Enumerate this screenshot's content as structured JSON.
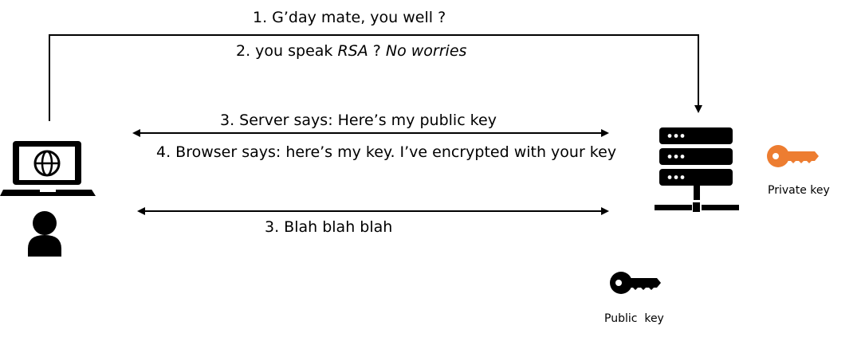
{
  "messages": {
    "m1": "1. G’day mate, you well ?",
    "m2_prefix": "2. you speak ",
    "m2_rsa": "RSA",
    "m2_middle": " ? ",
    "m2_suffix": "No worries",
    "m3": "3. Server says: Here’s my public key",
    "m4": "4. Browser says: here’s my key. I’ve encrypted with your key",
    "m5": "3. Blah blah blah"
  },
  "keys": {
    "private_label": "Private key",
    "public_label": "Public  key"
  },
  "icons": {
    "laptop": "laptop-globe-icon",
    "user": "user-icon",
    "server": "server-icon",
    "private_key": "key-icon",
    "public_key": "key-icon"
  },
  "colors": {
    "private_key": "#ED7D31",
    "public_key": "#000000",
    "lines": "#000000"
  }
}
